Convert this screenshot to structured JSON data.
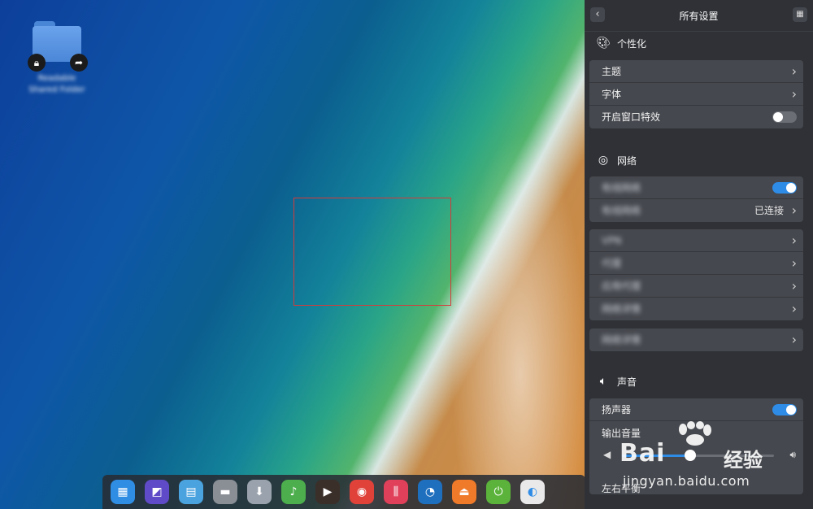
{
  "desktop": {
    "folder_label": "Readable Shared Folder",
    "lock_icon": "lock-icon",
    "share_icon": "share-arrow-icon"
  },
  "dock": {
    "icons": [
      {
        "name": "launcher-icon",
        "glyph": "▦",
        "color": "#2f8de4"
      },
      {
        "name": "screenshot-icon",
        "glyph": "◩",
        "color": "#5f4bc7"
      },
      {
        "name": "multitask-view-icon",
        "glyph": "▤",
        "color": "#4aa3df"
      },
      {
        "name": "file-manager-icon",
        "glyph": "▬",
        "color": "#8a8f96"
      },
      {
        "name": "app-store-icon",
        "glyph": "⬇",
        "color": "#9aa3ad"
      },
      {
        "name": "music-icon",
        "glyph": "♪",
        "color": "#4cae4c"
      },
      {
        "name": "movie-icon",
        "glyph": "▶",
        "color": "#3b2f2a"
      },
      {
        "name": "chrome-icon",
        "glyph": "◉",
        "color": "#e0423a"
      },
      {
        "name": "mixer-icon",
        "glyph": "⫼",
        "color": "#e0405a"
      },
      {
        "name": "system-monitor-icon",
        "glyph": "◔",
        "color": "#1f6fbf"
      },
      {
        "name": "eject-icon",
        "glyph": "⏏",
        "color": "#ef7a2a"
      },
      {
        "name": "power-icon",
        "glyph": "⏻",
        "color": "#5bb33b"
      },
      {
        "name": "control-center-icon",
        "glyph": "◐",
        "color": "#e9e9e9"
      }
    ]
  },
  "panel": {
    "title": "所有设置",
    "back_icon": "chevron-left-icon",
    "grid_icon": "grid-icon",
    "personalization": {
      "title": "个性化",
      "icon": "palette-icon",
      "rows": [
        {
          "label": "主题"
        },
        {
          "label": "字体"
        },
        {
          "label": "开启窗口特效",
          "toggle": false
        }
      ]
    },
    "network": {
      "title": "网络",
      "icon": "network-icon",
      "group1": [
        {
          "label": "有线网络",
          "toggle": true
        },
        {
          "label": "有线网络",
          "value": "已连接"
        }
      ],
      "group2": [
        {
          "label": "VPN"
        },
        {
          "label": "代理"
        },
        {
          "label": "应用代理"
        },
        {
          "label": "网络详情"
        }
      ],
      "group3": [
        {
          "label": "网络详情"
        }
      ]
    },
    "sound": {
      "title": "声音",
      "icon": "speaker-icon",
      "speaker_label": "扬声器",
      "speaker_on": true,
      "output_volume_label": "输出音量",
      "output_volume": 0.45,
      "balance_label": "左右平衡"
    }
  },
  "watermark": {
    "brand": "Bai",
    "brand_suffix": "经验",
    "url": "jingyan.baidu.com"
  }
}
